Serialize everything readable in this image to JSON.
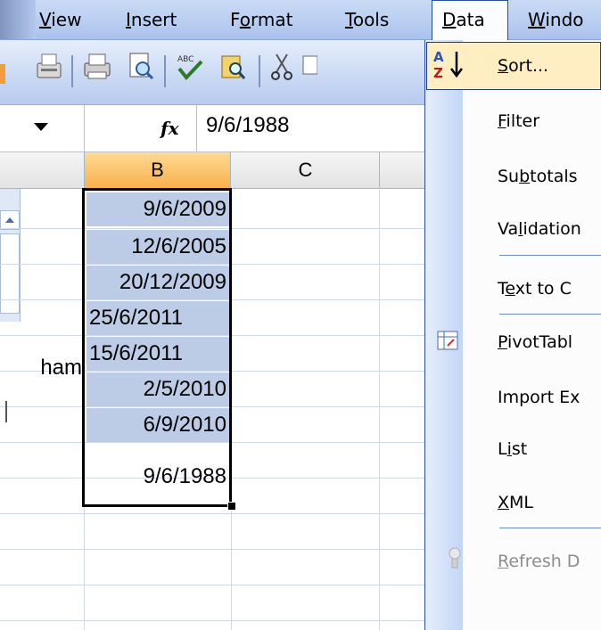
{
  "menubar": {
    "items": [
      {
        "label": "View",
        "u": "V"
      },
      {
        "label": "Insert",
        "u": "I"
      },
      {
        "label": "Format",
        "u": "o"
      },
      {
        "label": "Tools",
        "u": "T"
      },
      {
        "label": "Data",
        "u": "D"
      },
      {
        "label": "Windo",
        "u": "W"
      }
    ]
  },
  "formula_bar": {
    "fx": "fx",
    "value": "9/6/1988"
  },
  "columns": {
    "b": "B",
    "c": "C"
  },
  "cells": {
    "col_a": [
      "",
      "",
      "",
      "",
      "ham",
      "",
      "",
      ""
    ],
    "col_b": [
      "9/6/2009",
      "12/6/2005",
      "20/12/2009",
      "25/6/2011",
      "15/6/2011",
      "2/5/2010",
      "6/9/2010",
      "9/6/1988"
    ]
  },
  "data_menu": {
    "items": [
      {
        "label": "Sort...",
        "u": "S",
        "icon": "sort-ascending-icon",
        "enabled": true,
        "highlighted": true
      },
      {
        "label": "Filter",
        "u": "F",
        "enabled": true
      },
      {
        "label": "Subtotals",
        "u": "b",
        "enabled": true
      },
      {
        "label": "Validation",
        "u": "l",
        "enabled": true
      },
      {
        "label": "Text to C",
        "u": "e",
        "enabled": true
      },
      {
        "label": "PivotTabl",
        "u": "P",
        "icon": "pivottable-icon",
        "enabled": true
      },
      {
        "label": "Import Ex",
        "u": "",
        "enabled": true
      },
      {
        "label": "List",
        "u": "i",
        "enabled": true
      },
      {
        "label": "XML",
        "u": "X",
        "enabled": true
      },
      {
        "label": "Refresh D",
        "u": "R",
        "icon": "refresh-icon",
        "enabled": false
      }
    ]
  },
  "colors": {
    "accent": "#2b4f9f",
    "selection": "#bdcce6",
    "active_column": "#f8b04c",
    "menu_highlight": "#ffeec2"
  }
}
